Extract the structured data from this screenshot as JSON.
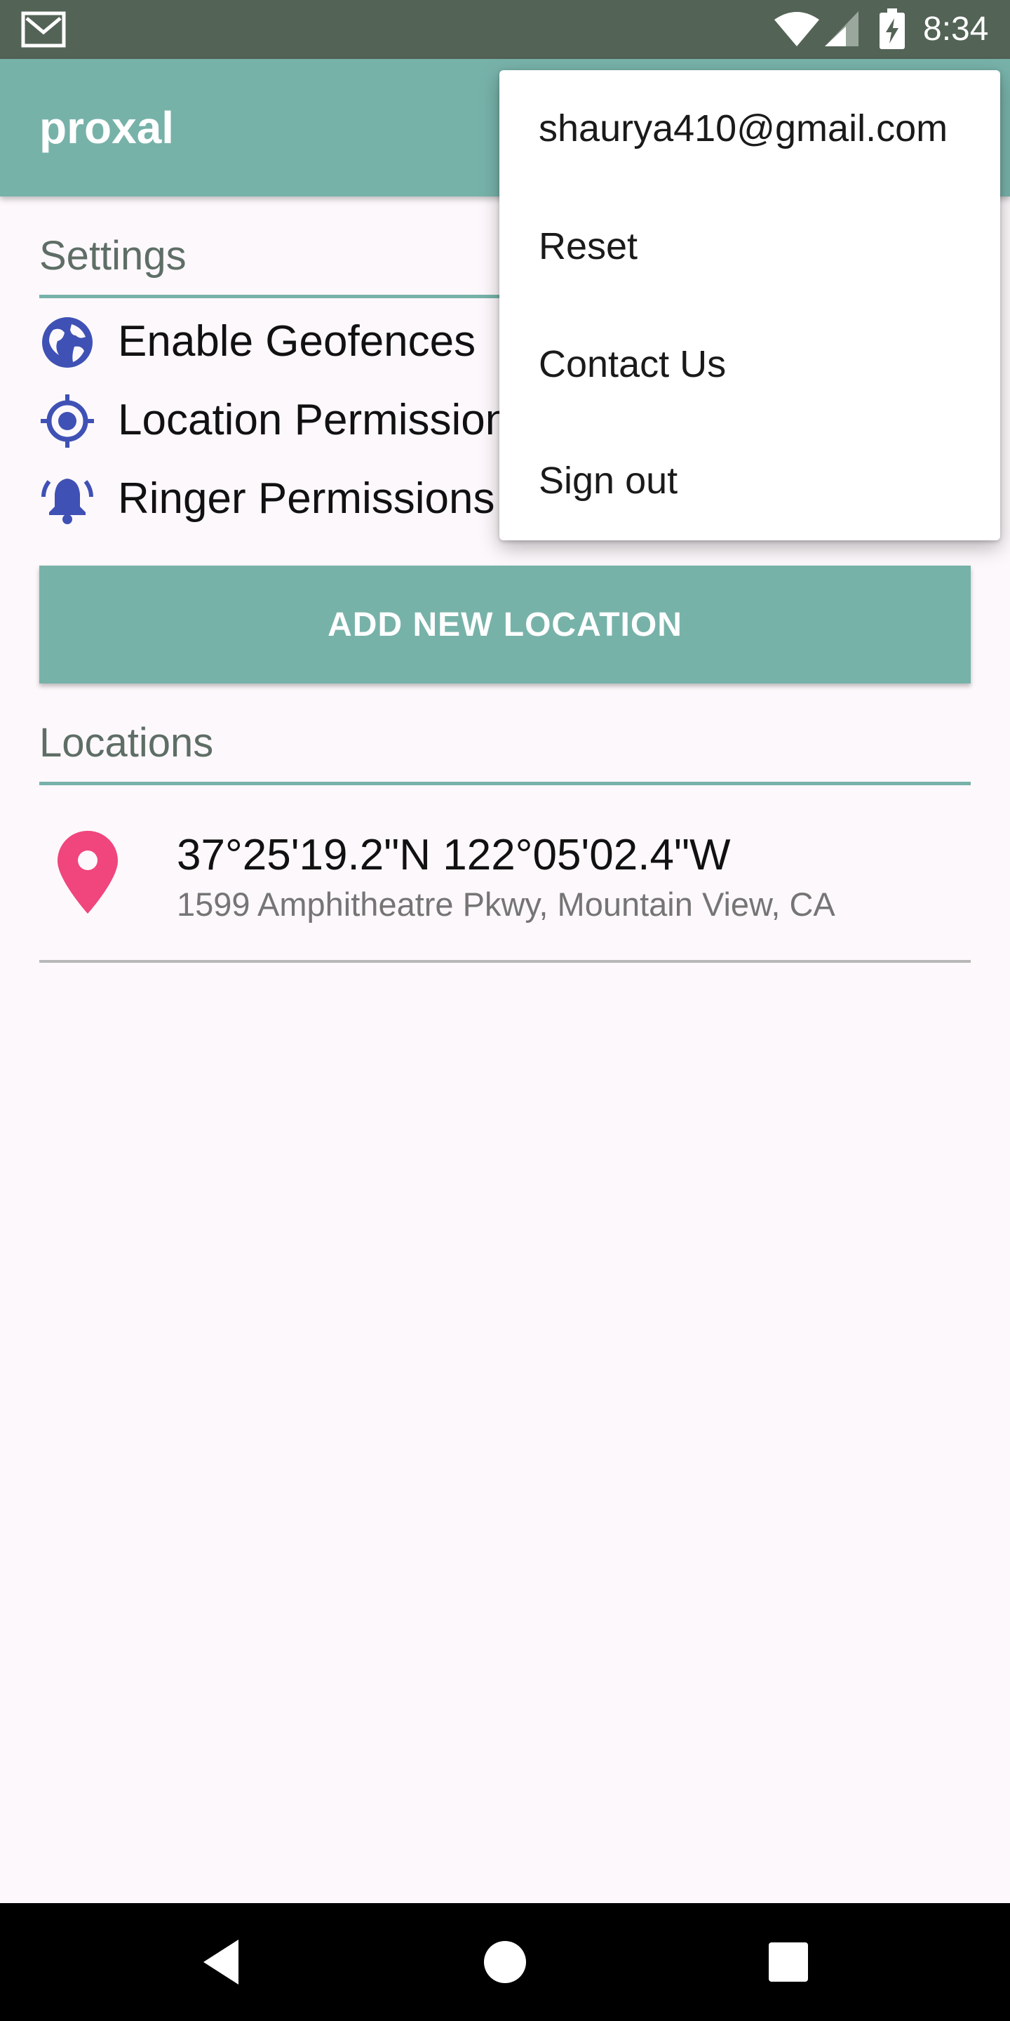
{
  "status_bar": {
    "time": "8:34",
    "icons": [
      "mail-icon",
      "wifi-icon",
      "signal-icon",
      "battery-charging-icon"
    ],
    "background": "#536356"
  },
  "app_bar": {
    "title": "proxal",
    "color": "#77b2a9"
  },
  "settings": {
    "header": "Settings",
    "items": [
      {
        "label": "Enable Geofences",
        "icon": "globe-icon"
      },
      {
        "label": "Location Permissions",
        "icon": "location-target-icon"
      },
      {
        "label": "Ringer Permissions",
        "icon": "bell-icon"
      }
    ],
    "icon_color": "#3f51b5"
  },
  "add_location_button": {
    "label": "ADD NEW LOCATION"
  },
  "locations": {
    "header": "Locations",
    "items": [
      {
        "coordinates": "37°25'19.2\"N 122°05'02.4\"W",
        "address": "1599 Amphitheatre Pkwy, Mountain View, CA",
        "icon": "map-pin-icon",
        "icon_color": "#f0457d"
      }
    ]
  },
  "overflow_menu": {
    "items": [
      {
        "label": "shaurya410@gmail.com"
      },
      {
        "label": "Reset"
      },
      {
        "label": "Contact Us"
      },
      {
        "label": "Sign out"
      }
    ]
  },
  "nav_bar": {
    "buttons": [
      "back-icon",
      "home-icon",
      "recents-icon"
    ]
  }
}
